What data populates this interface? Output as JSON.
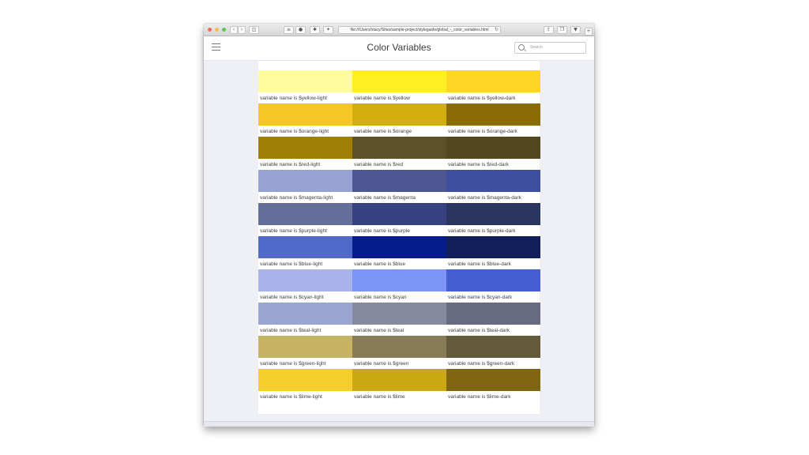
{
  "window": {
    "address": "file:///Users/stacy/Sites/sample-project/styleguide/global_-_color_variables.html",
    "traffic_lights": [
      "#ec6a5e",
      "#f4bf4f",
      "#61c554"
    ]
  },
  "header": {
    "title": "Color Variables",
    "search_placeholder": "Search"
  },
  "swatches": [
    [
      {
        "label": "variable name is $yellow-light",
        "color": "#fffc9f"
      },
      {
        "label": "variable name is $yellow",
        "color": "#ffee22"
      },
      {
        "label": "variable name is $yellow-dark",
        "color": "#ffd626"
      }
    ],
    [
      {
        "label": "variable name is $orange-light",
        "color": "#f4c724"
      },
      {
        "label": "variable name is $orange",
        "color": "#d2ae0f"
      },
      {
        "label": "variable name is $orange-dark",
        "color": "#8b6b04"
      }
    ],
    [
      {
        "label": "variable name is $red-light",
        "color": "#a07e08"
      },
      {
        "label": "variable name is $red",
        "color": "#5f5127"
      },
      {
        "label": "variable name is $red-dark",
        "color": "#53471e"
      }
    ],
    [
      {
        "label": "variable name is $magenta-light",
        "color": "#95a2d2"
      },
      {
        "label": "variable name is $magenta",
        "color": "#4d5892"
      },
      {
        "label": "variable name is $magenta-dark",
        "color": "#3e4f9f"
      }
    ],
    [
      {
        "label": "variable name is $purple-light",
        "color": "#646e9a"
      },
      {
        "label": "variable name is $purple",
        "color": "#354181"
      },
      {
        "label": "variable name is $purple-dark",
        "color": "#2b3660"
      }
    ],
    [
      {
        "label": "variable name is $blue-light",
        "color": "#5169c8"
      },
      {
        "label": "variable name is $blue",
        "color": "#071c8c"
      },
      {
        "label": "variable name is $blue-dark",
        "color": "#111e5a"
      }
    ],
    [
      {
        "label": "variable name is $cyan-light",
        "color": "#a7b3ea"
      },
      {
        "label": "variable name is $cyan",
        "color": "#7c94f4"
      },
      {
        "label": "variable name is $cyan-dark",
        "color": "#445fd1"
      }
    ],
    [
      {
        "label": "variable name is $teal-light",
        "color": "#9aa5d1"
      },
      {
        "label": "variable name is $teal",
        "color": "#868a9e"
      },
      {
        "label": "variable name is $teal-dark",
        "color": "#666b81"
      }
    ],
    [
      {
        "label": "variable name is $green-light",
        "color": "#c6b464"
      },
      {
        "label": "variable name is $green",
        "color": "#877b58"
      },
      {
        "label": "variable name is $green-dark",
        "color": "#635a3c"
      }
    ],
    [
      {
        "label": "variable name is $lime-light",
        "color": "#f4cf2a"
      },
      {
        "label": "variable name is $lime",
        "color": "#cba914"
      },
      {
        "label": "variable name is $lime-dark",
        "color": "#806610"
      }
    ]
  ]
}
